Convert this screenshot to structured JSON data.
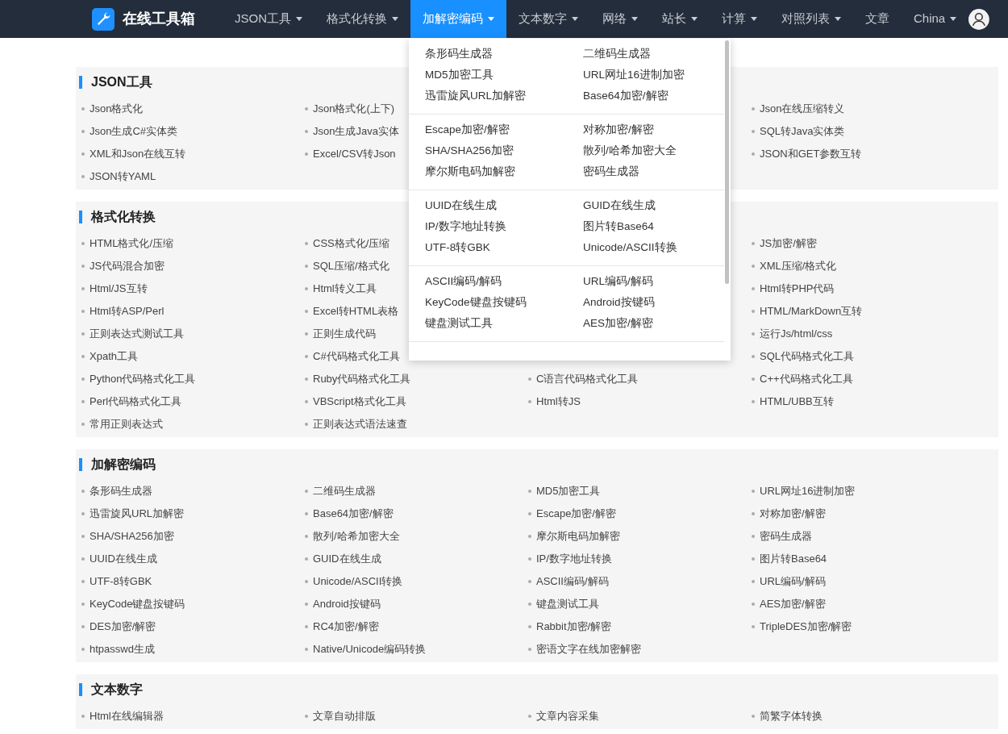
{
  "header": {
    "logo_text": "在线工具箱",
    "nav": [
      {
        "label": "JSON工具",
        "caret": true,
        "selected": false
      },
      {
        "label": "格式化转换",
        "caret": true,
        "selected": false
      },
      {
        "label": "加解密编码",
        "caret": true,
        "selected": true
      },
      {
        "label": "文本数字",
        "caret": true,
        "selected": false
      },
      {
        "label": "网络",
        "caret": true,
        "selected": false
      },
      {
        "label": "站长",
        "caret": true,
        "selected": false
      },
      {
        "label": "计算",
        "caret": true,
        "selected": false
      },
      {
        "label": "对照列表",
        "caret": true,
        "selected": false
      },
      {
        "label": "文章",
        "caret": false,
        "selected": false
      },
      {
        "label": "China",
        "caret": true,
        "selected": false
      }
    ]
  },
  "dropdown": {
    "groups": [
      [
        [
          "条形码生成器",
          "二维码生成器"
        ],
        [
          "MD5加密工具",
          "URL网址16进制加密"
        ],
        [
          "迅雷旋风URL加解密",
          "Base64加密/解密"
        ]
      ],
      [
        [
          "Escape加密/解密",
          "对称加密/解密"
        ],
        [
          "SHA/SHA256加密",
          "散列/哈希加密大全"
        ],
        [
          "摩尔斯电码加解密",
          "密码生成器"
        ]
      ],
      [
        [
          "UUID在线生成",
          "GUID在线生成"
        ],
        [
          "IP/数字地址转换",
          "图片转Base64"
        ],
        [
          "UTF-8转GBK",
          "Unicode/ASCII转换"
        ]
      ],
      [
        [
          "ASCII编码/解码",
          "URL编码/解码"
        ],
        [
          "KeyCode键盘按键码",
          "Android按键码"
        ],
        [
          "键盘测试工具",
          "AES加密/解密"
        ]
      ]
    ]
  },
  "sections": [
    {
      "title": "JSON工具",
      "rows": [
        [
          "Json格式化",
          "Json格式化(上下)",
          null,
          "Json在线压缩转义"
        ],
        [
          "Json生成C#实体类",
          "Json生成Java实体",
          null,
          "SQL转Java实体类"
        ],
        [
          "XML和Json在线互转",
          "Excel/CSV转Json",
          null,
          "JSON和GET参数互转"
        ],
        [
          "JSON转YAML"
        ]
      ]
    },
    {
      "title": "格式化转换",
      "rows": [
        [
          "HTML格式化/压缩",
          "CSS格式化/压缩",
          null,
          "JS加密/解密"
        ],
        [
          "JS代码混合加密",
          "SQL压缩/格式化",
          null,
          "XML压缩/格式化"
        ],
        [
          "Html/JS互转",
          "Html转义工具",
          null,
          "Html转PHP代码"
        ],
        [
          "Html转ASP/Perl",
          "Excel转HTML表格",
          null,
          "HTML/MarkDown互转"
        ],
        [
          "正则表达式测试工具",
          "正则生成代码",
          null,
          "运行Js/html/css"
        ],
        [
          "Xpath工具",
          "C#代码格式化工具",
          null,
          "SQL代码格式化工具"
        ],
        [
          "Python代码格式化工具",
          "Ruby代码格式化工具",
          "C语言代码格式化工具",
          "C++代码格式化工具"
        ],
        [
          "Perl代码格式化工具",
          "VBScript格式化工具",
          "Html转JS",
          "HTML/UBB互转"
        ],
        [
          "常用正则表达式",
          "正则表达式语法速查"
        ]
      ]
    },
    {
      "title": "加解密编码",
      "rows": [
        [
          "条形码生成器",
          "二维码生成器",
          "MD5加密工具",
          "URL网址16进制加密"
        ],
        [
          "迅雷旋风URL加解密",
          "Base64加密/解密",
          "Escape加密/解密",
          "对称加密/解密"
        ],
        [
          "SHA/SHA256加密",
          "散列/哈希加密大全",
          "摩尔斯电码加解密",
          "密码生成器"
        ],
        [
          "UUID在线生成",
          "GUID在线生成",
          "IP/数字地址转换",
          "图片转Base64"
        ],
        [
          "UTF-8转GBK",
          "Unicode/ASCII转换",
          "ASCII编码/解码",
          "URL编码/解码"
        ],
        [
          "KeyCode键盘按键码",
          "Android按键码",
          "键盘测试工具",
          "AES加密/解密"
        ],
        [
          "DES加密/解密",
          "RC4加密/解密",
          "Rabbit加密/解密",
          "TripleDES加密/解密"
        ],
        [
          "htpasswd生成",
          "Native/Unicode编码转换",
          "密语文字在线加密解密"
        ]
      ]
    },
    {
      "title": "文本数字",
      "rows": [
        [
          "Html在线编辑器",
          "文章自动排版",
          "文章内容采集",
          "简繁字体转换"
        ]
      ]
    }
  ]
}
